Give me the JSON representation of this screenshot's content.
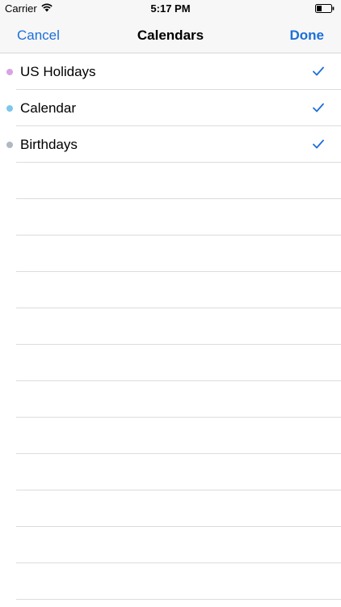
{
  "status_bar": {
    "carrier": "Carrier",
    "time": "5:17 PM",
    "icons": [
      "wifi-icon",
      "battery-icon"
    ]
  },
  "nav": {
    "cancel_label": "Cancel",
    "title": "Calendars",
    "done_label": "Done"
  },
  "colors": {
    "accent": "#1c6fd9"
  },
  "calendars": [
    {
      "name": "US Holidays",
      "color": "#d9a3e3",
      "checked": true
    },
    {
      "name": "Calendar",
      "color": "#7ec6ec",
      "checked": true
    },
    {
      "name": "Birthdays",
      "color": "#b0b8c4",
      "checked": true
    }
  ]
}
